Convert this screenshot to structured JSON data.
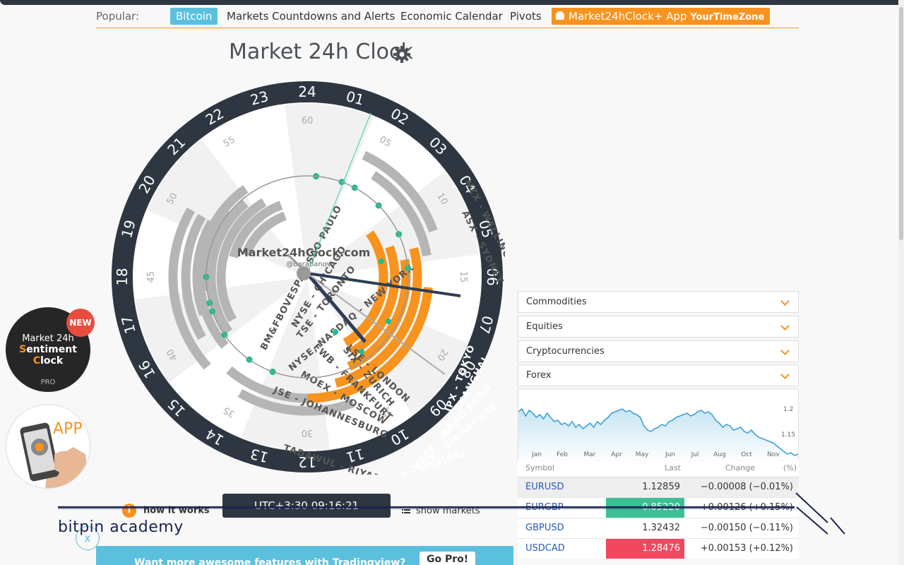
{
  "nav": {
    "popular_label": "Popular:",
    "bitcoin": "Bitcoin",
    "countdowns": "Markets Countdowns and Alerts",
    "calendar": "Economic Calendar",
    "pivots": "Pivots",
    "app_label": "Market24hClock+ App",
    "app_suffix": "YourTimeZone"
  },
  "clock": {
    "title": "Market 24h Clock",
    "brand": "Market24hClock.com",
    "author": "@barabanov",
    "hours": [
      "24",
      "01",
      "02",
      "03",
      "04",
      "05",
      "06",
      "07",
      "08",
      "09",
      "10",
      "11",
      "12",
      "13",
      "14",
      "15",
      "16",
      "17",
      "18",
      "19",
      "20",
      "21",
      "22",
      "23"
    ],
    "minutes": [
      "60",
      "05",
      "10",
      "15",
      "20",
      "25",
      "30",
      "35",
      "40",
      "45",
      "50",
      "55"
    ],
    "markets_gray": [
      "BM&FBOVESPA - SAO PAULO",
      "NYSE - CHICAGO",
      "TSE - TORONTO",
      "NYSE, NASDAQ - NEW YORK",
      "NZX - WELLINGTON",
      "ASX - SYDNEY",
      "LSE - LONDON",
      "SIX - ZURICH",
      "FWB - FRANKFURT",
      "MOEX - MOSCOW",
      "JSE - JOHANNESBURG",
      "TADAWUL - RIYADH",
      "DFM - DUBAI"
    ],
    "markets_orange": [
      "JPX - TOKYO",
      "SSE - SHANGHAI",
      "HKEX - HONG KONG",
      "SGX - SINGAPORE",
      "NSE - MUMBAI"
    ],
    "accent": "#f7931e",
    "ring": "#2d3641"
  },
  "promos": {
    "sentiment": {
      "badge": "NEW",
      "line1": "Market 24h",
      "line2_first": "S",
      "line2_rest": "entiment",
      "line3_first": "C",
      "line3_rest": "lock",
      "tier": "PRO"
    },
    "app": {
      "label": "APP"
    }
  },
  "widget": {
    "sections": [
      "Commodities",
      "Equities",
      "Cryptocurrencies",
      "Forex"
    ],
    "chart_months": [
      "Jan",
      "Feb",
      "Mar",
      "Apr",
      "May",
      "Jun",
      "Jul",
      "Aug",
      "Oct",
      "Nov"
    ],
    "chart_yticks": [
      "1.2",
      "1.15"
    ],
    "headers": {
      "symbol": "Symbol",
      "last": "Last",
      "change": "Change",
      "pct": "(%)"
    },
    "rows": [
      {
        "symbol": "EURUSD",
        "last": "1.12859",
        "change": "−0.00008 (−0.01%)",
        "bg": "#eeeeee",
        "lastbg": "",
        "lastcolor": "#333"
      },
      {
        "symbol": "EURGBP",
        "last": "0.85220",
        "change": "+0.00126 (+0.15%)",
        "bg": "#ffffff",
        "lastbg": "#3cbf95",
        "lastcolor": "#ffffff"
      },
      {
        "symbol": "GBPUSD",
        "last": "1.32432",
        "change": "−0.00150 (−0.11%)",
        "bg": "#ffffff",
        "lastbg": "",
        "lastcolor": "#333"
      },
      {
        "symbol": "USDCAD",
        "last": "1.28476",
        "change": "+0.00153 (+0.12%)",
        "bg": "#ffffff",
        "lastbg": "#f2485f",
        "lastcolor": "#ffffff"
      }
    ]
  },
  "bottom": {
    "how_it_works": "how it works",
    "utc": "UTC+3:30 09:16:21",
    "show_markets": "show markets",
    "bitpin": "bitpin academy",
    "close": "x",
    "tv_text": "Want more awesome features with Tradingview?",
    "tv_button": "Go Pro!"
  }
}
